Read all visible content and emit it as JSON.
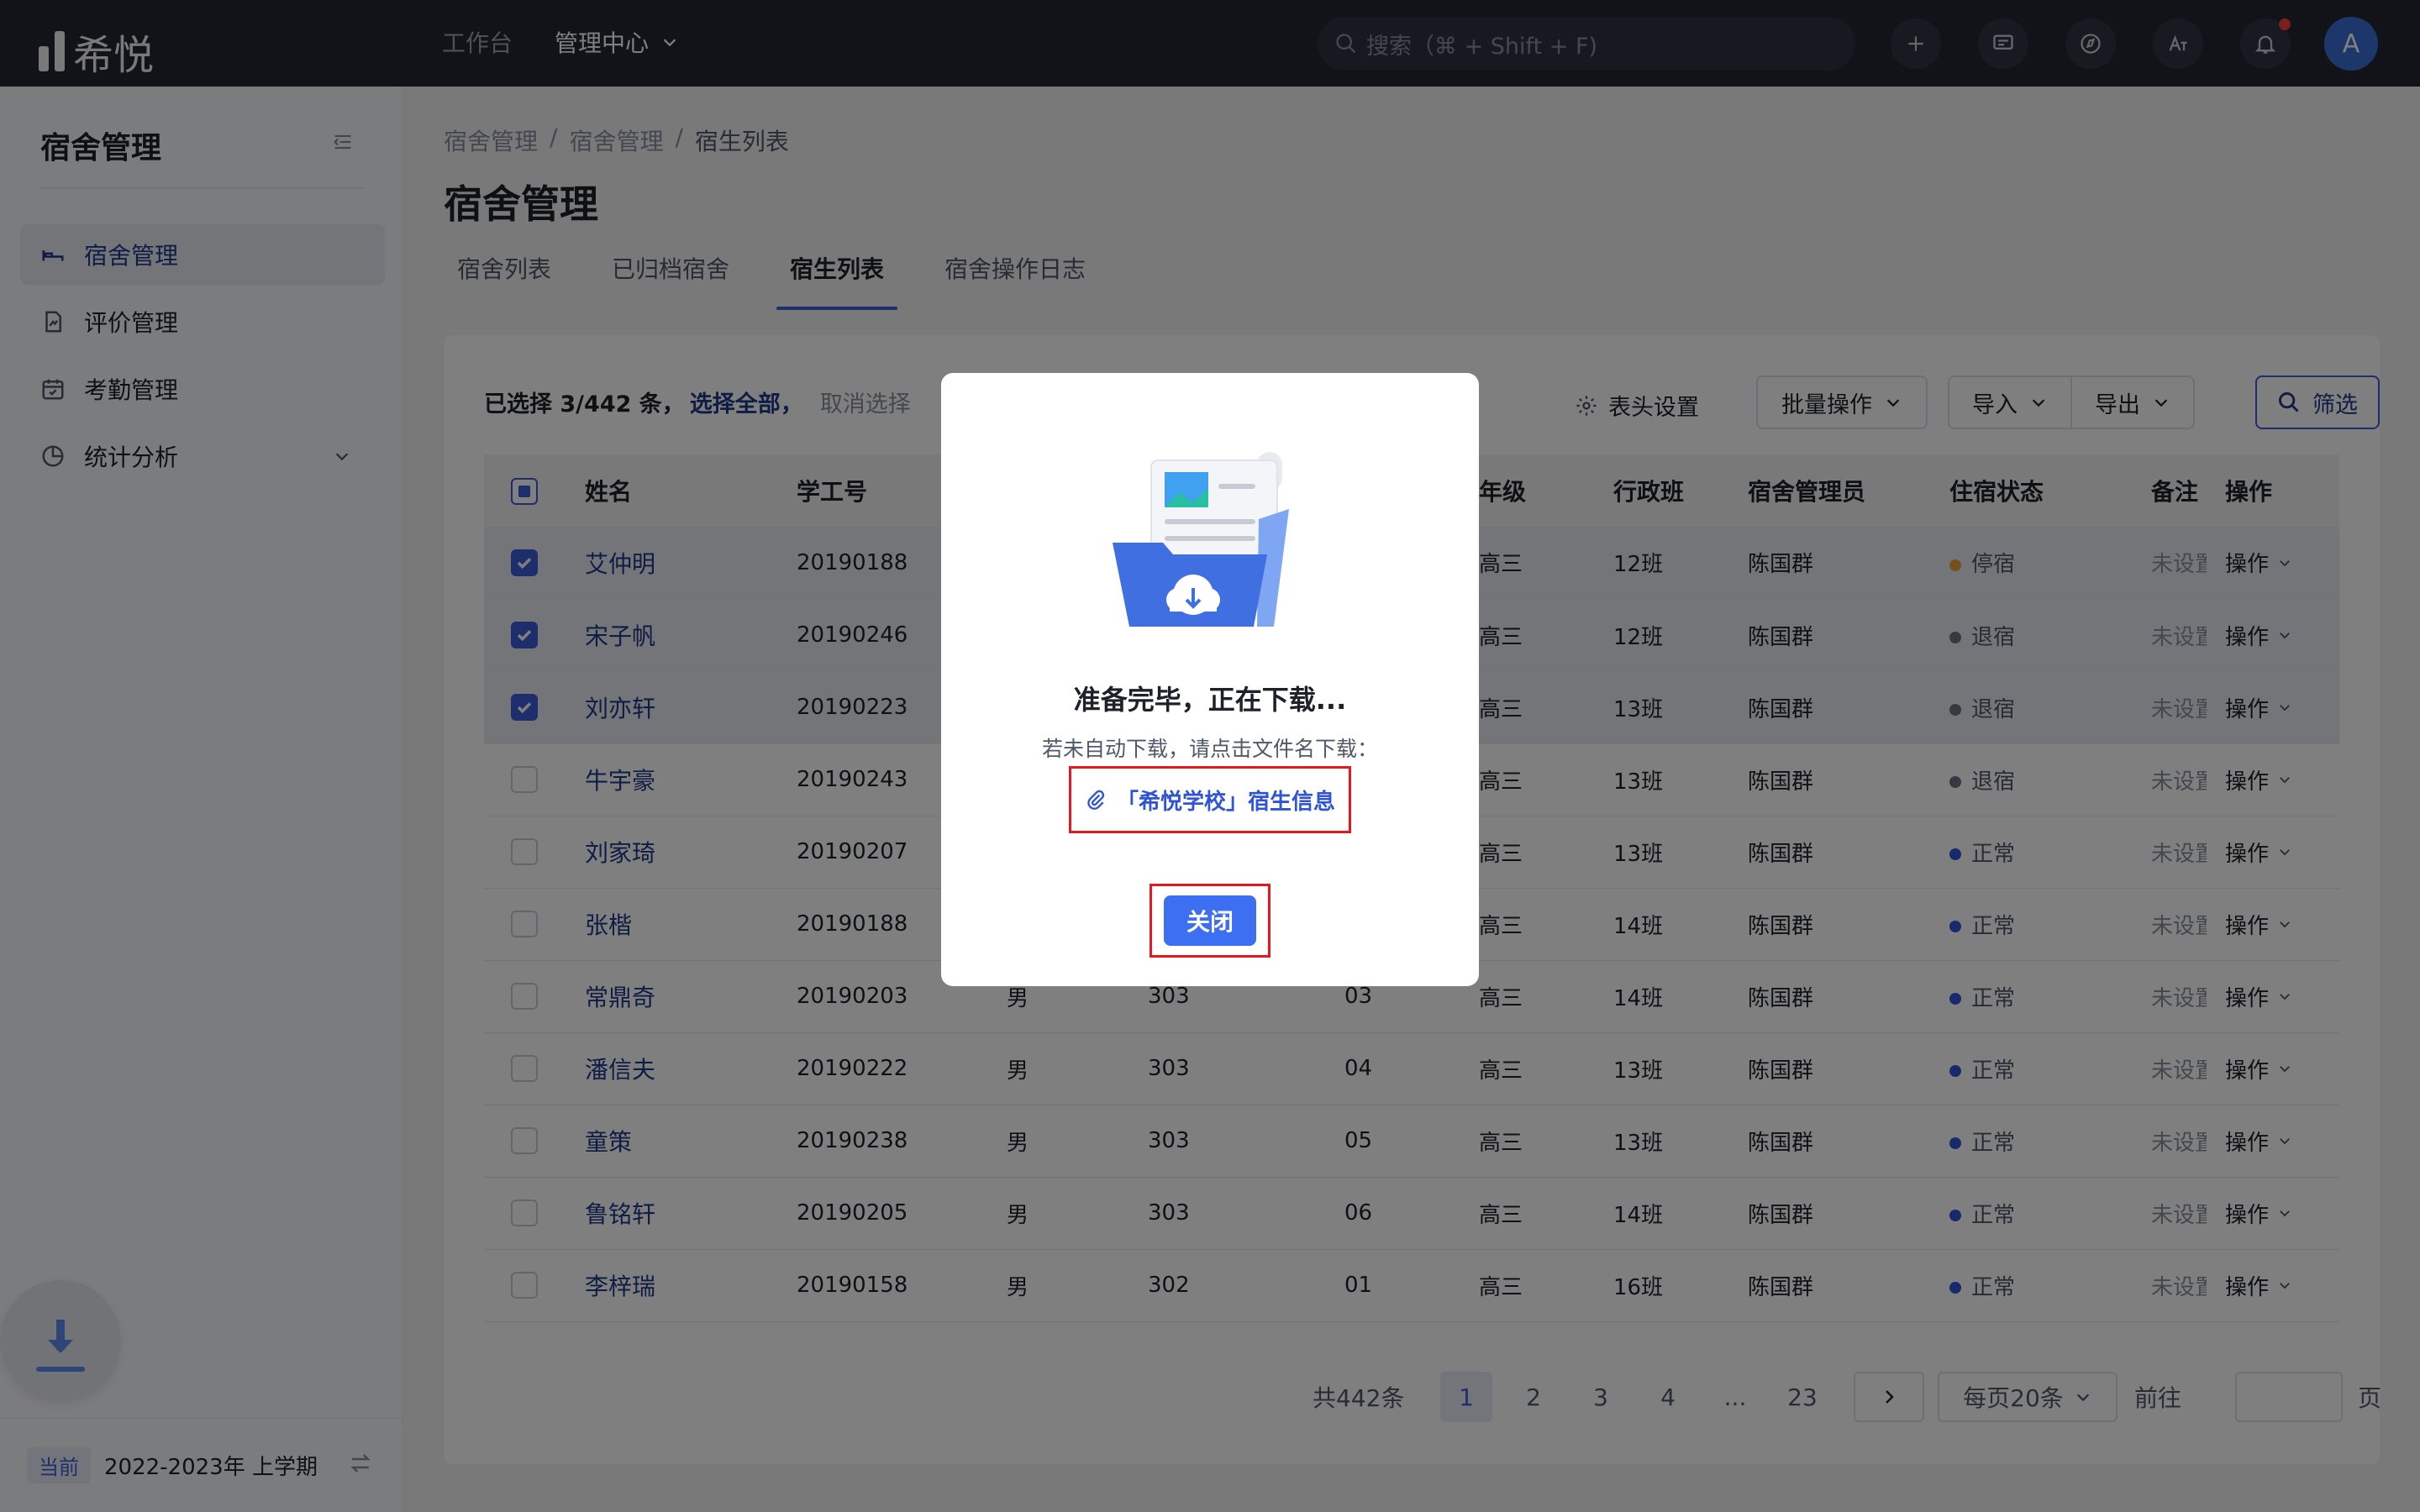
{
  "app": {
    "logo_text": "希悦"
  },
  "topnav": {
    "workbench": "工作台",
    "admin": "管理中心"
  },
  "search": {
    "placeholder": "搜索（⌘ + Shift + F)"
  },
  "user": {
    "avatar_letter": "A"
  },
  "sidebar": {
    "title": "宿舍管理",
    "items": [
      {
        "label": "宿舍管理",
        "icon": "bed-icon"
      },
      {
        "label": "评价管理",
        "icon": "evaluation-icon"
      },
      {
        "label": "考勤管理",
        "icon": "calendar-icon"
      },
      {
        "label": "统计分析",
        "icon": "pie-chart-icon"
      }
    ],
    "term_tag": "当前",
    "term_value": "2022-2023年 上学期"
  },
  "breadcrumb": [
    "宿舍管理",
    "宿舍管理",
    "宿生列表"
  ],
  "page_title": "宿舍管理",
  "tabs": [
    "宿舍列表",
    "已归档宿舍",
    "宿生列表",
    "宿舍操作日志"
  ],
  "selection": {
    "text": "已选择 3/442 条，",
    "select_all": "选择全部，",
    "cancel": "取消选择"
  },
  "toolbar": {
    "header_settings": "表头设置",
    "batch": "批量操作",
    "import": "导入",
    "export": "导出",
    "filter": "筛选"
  },
  "table": {
    "columns": [
      "姓名",
      "学工号",
      "",
      "",
      "",
      "年级",
      "行政班",
      "宿舍管理员",
      "住宿状态",
      "备注",
      "操作"
    ],
    "rows": [
      {
        "sel": true,
        "name": "艾仲明",
        "id": "20190188",
        "gender": "",
        "room": "",
        "bed": "",
        "grade": "高三",
        "class": "12班",
        "manager": "陈国群",
        "status": "停宿",
        "note": "未设置",
        "op": "操作"
      },
      {
        "sel": true,
        "name": "宋子帆",
        "id": "20190246",
        "gender": "",
        "room": "",
        "bed": "",
        "grade": "高三",
        "class": "12班",
        "manager": "陈国群",
        "status": "退宿",
        "note": "未设置",
        "op": "操作"
      },
      {
        "sel": true,
        "name": "刘亦轩",
        "id": "20190223",
        "gender": "",
        "room": "",
        "bed": "",
        "grade": "高三",
        "class": "13班",
        "manager": "陈国群",
        "status": "退宿",
        "note": "未设置",
        "op": "操作"
      },
      {
        "sel": false,
        "name": "牛宇豪",
        "id": "20190243",
        "gender": "",
        "room": "",
        "bed": "",
        "grade": "高三",
        "class": "13班",
        "manager": "陈国群",
        "status": "退宿",
        "note": "未设置",
        "op": "操作"
      },
      {
        "sel": false,
        "name": "刘家琦",
        "id": "20190207",
        "gender": "",
        "room": "",
        "bed": "",
        "grade": "高三",
        "class": "13班",
        "manager": "陈国群",
        "status": "正常",
        "note": "未设置",
        "op": "操作"
      },
      {
        "sel": false,
        "name": "张楷",
        "id": "20190188",
        "gender": "",
        "room": "",
        "bed": "",
        "grade": "高三",
        "class": "14班",
        "manager": "陈国群",
        "status": "正常",
        "note": "未设置",
        "op": "操作"
      },
      {
        "sel": false,
        "name": "常鼎奇",
        "id": "20190203",
        "gender": "男",
        "room": "303",
        "bed": "03",
        "grade": "高三",
        "class": "14班",
        "manager": "陈国群",
        "status": "正常",
        "note": "未设置",
        "op": "操作"
      },
      {
        "sel": false,
        "name": "潘信夫",
        "id": "20190222",
        "gender": "男",
        "room": "303",
        "bed": "04",
        "grade": "高三",
        "class": "13班",
        "manager": "陈国群",
        "status": "正常",
        "note": "未设置",
        "op": "操作"
      },
      {
        "sel": false,
        "name": "童策",
        "id": "20190238",
        "gender": "男",
        "room": "303",
        "bed": "05",
        "grade": "高三",
        "class": "13班",
        "manager": "陈国群",
        "status": "正常",
        "note": "未设置",
        "op": "操作"
      },
      {
        "sel": false,
        "name": "鲁铭轩",
        "id": "20190205",
        "gender": "男",
        "room": "303",
        "bed": "06",
        "grade": "高三",
        "class": "14班",
        "manager": "陈国群",
        "status": "正常",
        "note": "未设置",
        "op": "操作"
      },
      {
        "sel": false,
        "name": "李梓瑞",
        "id": "20190158",
        "gender": "男",
        "room": "302",
        "bed": "01",
        "grade": "高三",
        "class": "16班",
        "manager": "陈国群",
        "status": "正常",
        "note": "未设置",
        "op": "操作"
      }
    ]
  },
  "status_colors": {
    "停宿": "#e6a23c",
    "退宿": "#6b7280",
    "正常": "#2f54d6"
  },
  "pagination": {
    "total": "共442条",
    "pages": [
      "1",
      "2",
      "3",
      "4",
      "...",
      "23"
    ],
    "page_size": "每页20条",
    "goto": "前往",
    "page_unit": "页"
  },
  "modal": {
    "title": "准备完毕，正在下载...",
    "desc": "若未自动下载，请点击文件名下载：",
    "file_name": "「希悦学校」宿生信息",
    "close": "关闭"
  }
}
